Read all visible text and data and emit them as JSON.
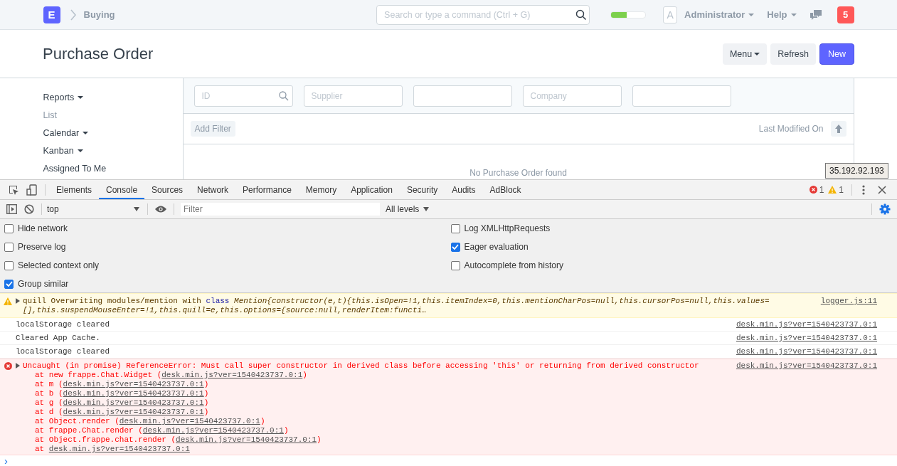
{
  "navbar": {
    "logo": "E",
    "breadcrumb": "Buying",
    "search": {
      "placeholder": "Search or type a command (Ctrl + G)"
    },
    "progress": {
      "level": 0.45
    },
    "avatar": "A",
    "user": "Administrator",
    "help": "Help",
    "notifications": "5"
  },
  "page": {
    "title": "Purchase Order",
    "buttons": [
      {
        "label": "Menu",
        "kind": "dropdown"
      },
      {
        "label": "Refresh",
        "kind": "default"
      },
      {
        "label": "New",
        "kind": "primary"
      }
    ]
  },
  "sidebar": {
    "items": [
      {
        "label": "Reports",
        "dropdown": true,
        "selected": false
      },
      {
        "label": "List",
        "dropdown": false,
        "selected": true
      },
      {
        "label": "Calendar",
        "dropdown": true,
        "selected": false
      },
      {
        "label": "Kanban",
        "dropdown": true,
        "selected": false
      },
      {
        "label": "Assigned To Me",
        "dropdown": false,
        "selected": false
      }
    ]
  },
  "list": {
    "filters": [
      {
        "kind": "search",
        "placeholder": "ID"
      },
      {
        "kind": "text",
        "placeholder": "Supplier"
      },
      {
        "kind": "text"
      },
      {
        "kind": "text",
        "placeholder": "Company"
      },
      {
        "kind": "text"
      }
    ],
    "add_filter": "Add Filter",
    "sort_label": "Last Modified On",
    "empty_message": "No Purchase Order found"
  },
  "tooltip": "35.192.92.193",
  "devtools": {
    "tabs": [
      {
        "label": "Elements",
        "selected": false
      },
      {
        "label": "Console",
        "selected": true
      },
      {
        "label": "Sources",
        "selected": false
      },
      {
        "label": "Network",
        "selected": false
      },
      {
        "label": "Performance",
        "selected": false
      },
      {
        "label": "Memory",
        "selected": false
      },
      {
        "label": "Application",
        "selected": false
      },
      {
        "label": "Security",
        "selected": false
      },
      {
        "label": "Audits",
        "selected": false
      },
      {
        "label": "AdBlock",
        "selected": false
      }
    ],
    "error_count": "1",
    "warning_count": "1",
    "context": "top",
    "filter": {
      "placeholder": "Filter"
    },
    "levels": "All levels",
    "settings": {
      "left": [
        {
          "label": "Hide network",
          "checked": false
        },
        {
          "label": "Preserve log",
          "checked": false
        },
        {
          "label": "Selected context only",
          "checked": false
        },
        {
          "label": "Group similar",
          "checked": true
        }
      ],
      "right": [
        {
          "label": "Log XMLHttpRequests",
          "checked": false
        },
        {
          "label": "Eager evaluation",
          "checked": true
        },
        {
          "label": "Autocomplete from history",
          "checked": false
        }
      ]
    },
    "messages": [
      {
        "kind": "warning",
        "parts": [
          {
            "kind": "plain",
            "text": "quill Overwriting modules/mention with "
          },
          {
            "kind": "keyword",
            "text": "class"
          },
          {
            "kind": "code",
            "text": " Mention{constructor(e,t){this.isOpen=!1,this.itemIndex=0,this.mentionCharPos=null,this.cursorPos=null,this.values=[],this.suspendMouseEnter=!1,this.quill=e,this.options={source:null,renderItem:functi…"
          }
        ],
        "source": "logger.js:11"
      },
      {
        "kind": "log",
        "text": "localStorage cleared",
        "source": "desk.min.js?ver=1540423737.0:1"
      },
      {
        "kind": "log",
        "text": "Cleared App Cache.",
        "source": "desk.min.js?ver=1540423737.0:1"
      },
      {
        "kind": "log",
        "text": "localStorage cleared",
        "source": "desk.min.js?ver=1540423737.0:1"
      },
      {
        "kind": "error",
        "text": "Uncaught (in promise) ReferenceError: Must call super constructor in derived class before accessing 'this' or returning from derived constructor",
        "source": "desk.min.js?ver=1540423737.0:1",
        "stack": [
          {
            "prefix": "at new frappe.Chat.Widget (",
            "link": "desk.min.js?ver=1540423737.0:1",
            "suffix": ")"
          },
          {
            "prefix": "at m (",
            "link": "desk.min.js?ver=1540423737.0:1",
            "suffix": ")"
          },
          {
            "prefix": "at b (",
            "link": "desk.min.js?ver=1540423737.0:1",
            "suffix": ")"
          },
          {
            "prefix": "at g (",
            "link": "desk.min.js?ver=1540423737.0:1",
            "suffix": ")"
          },
          {
            "prefix": "at d (",
            "link": "desk.min.js?ver=1540423737.0:1",
            "suffix": ")"
          },
          {
            "prefix": "at Object.render (",
            "link": "desk.min.js?ver=1540423737.0:1",
            "suffix": ")"
          },
          {
            "prefix": "at frappe.Chat.render (",
            "link": "desk.min.js?ver=1540423737.0:1",
            "suffix": ")"
          },
          {
            "prefix": "at Object.frappe.chat.render (",
            "link": "desk.min.js?ver=1540423737.0:1",
            "suffix": ")"
          },
          {
            "prefix": "at ",
            "link": "desk.min.js?ver=1540423737.0:1"
          }
        ]
      }
    ],
    "prompt": "›"
  }
}
